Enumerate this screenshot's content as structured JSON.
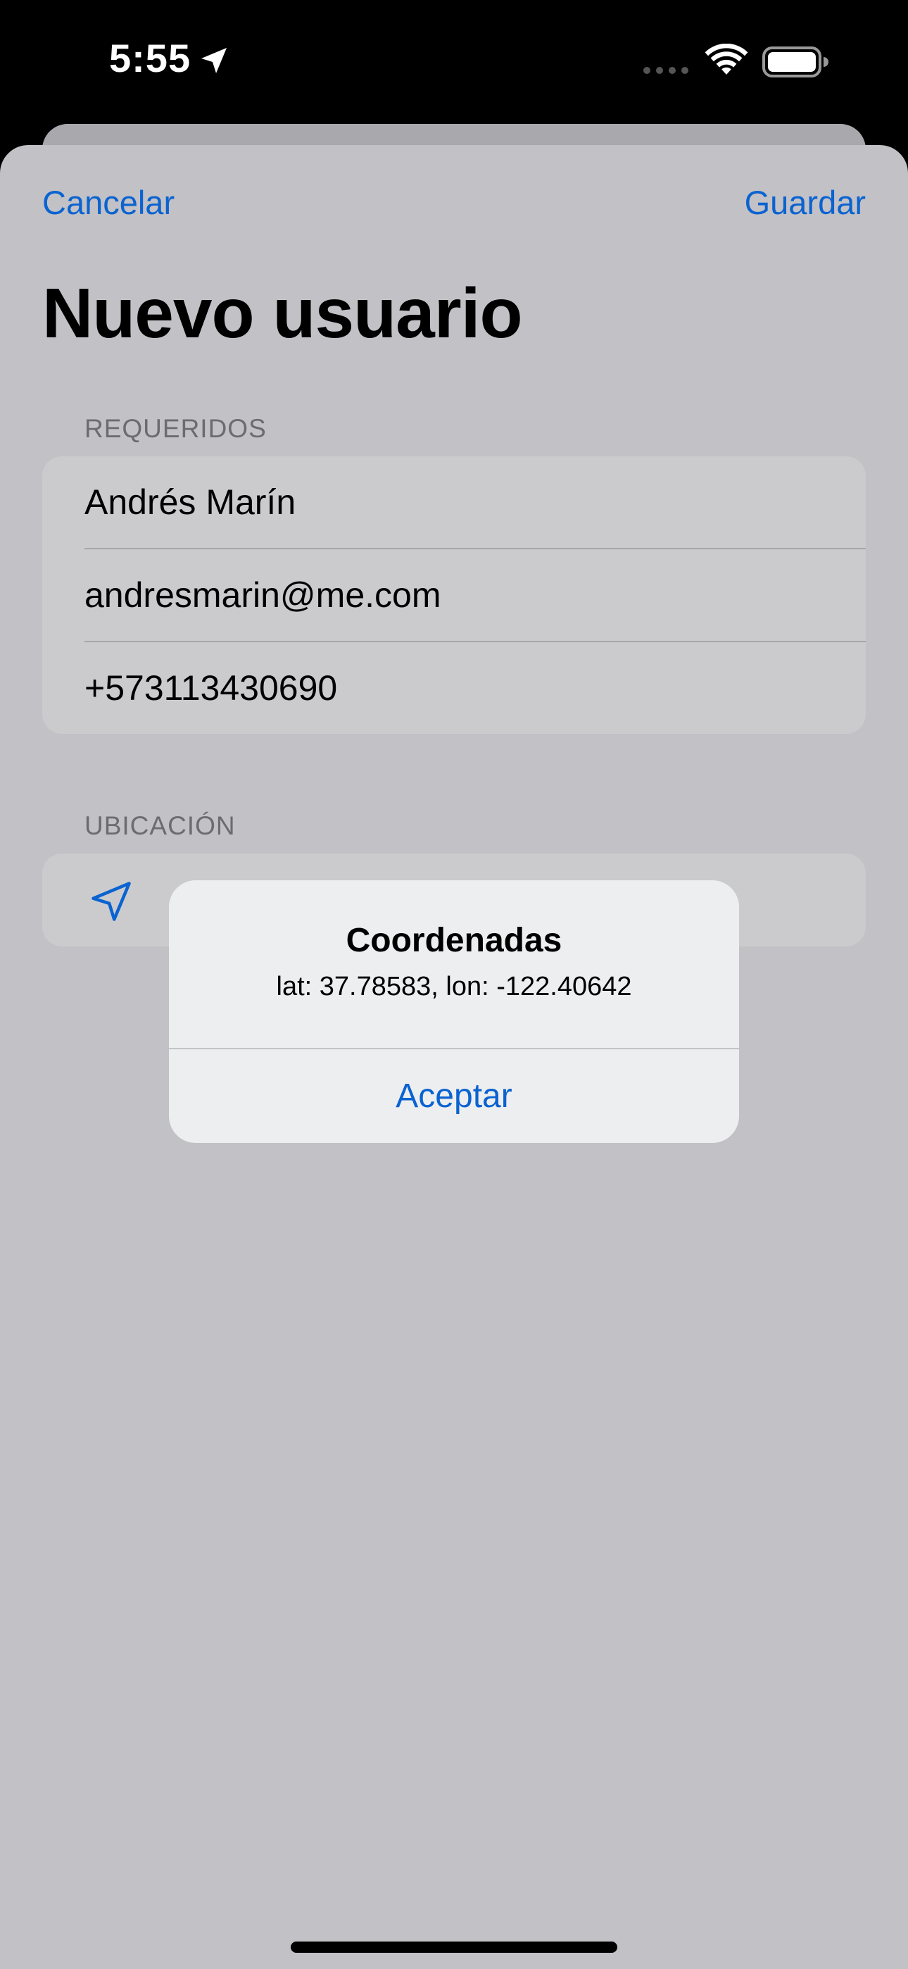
{
  "status_bar": {
    "time": "5:55",
    "icons": [
      "location-arrow-icon",
      "cellular-signal-icon",
      "wifi-icon",
      "battery-icon"
    ]
  },
  "nav": {
    "cancel_label": "Cancelar",
    "save_label": "Guardar"
  },
  "page": {
    "title": "Nuevo usuario"
  },
  "sections": {
    "required": {
      "header": "REQUERIDOS",
      "rows": [
        {
          "value": "Andrés Marín"
        },
        {
          "value": "andresmarin@me.com"
        },
        {
          "value": "+573113430690"
        }
      ]
    },
    "location": {
      "header": "UBICACIÓN",
      "icon": "location-arrow-icon"
    }
  },
  "alert": {
    "title": "Coordenadas",
    "message": "lat: 37.78583, lon: -122.40642",
    "button_label": "Aceptar"
  },
  "colors": {
    "accent": "#0a63d0",
    "sheet_background": "#c2c1c6",
    "group_background": "#cbcbcd",
    "alert_background": "#edeef0"
  }
}
